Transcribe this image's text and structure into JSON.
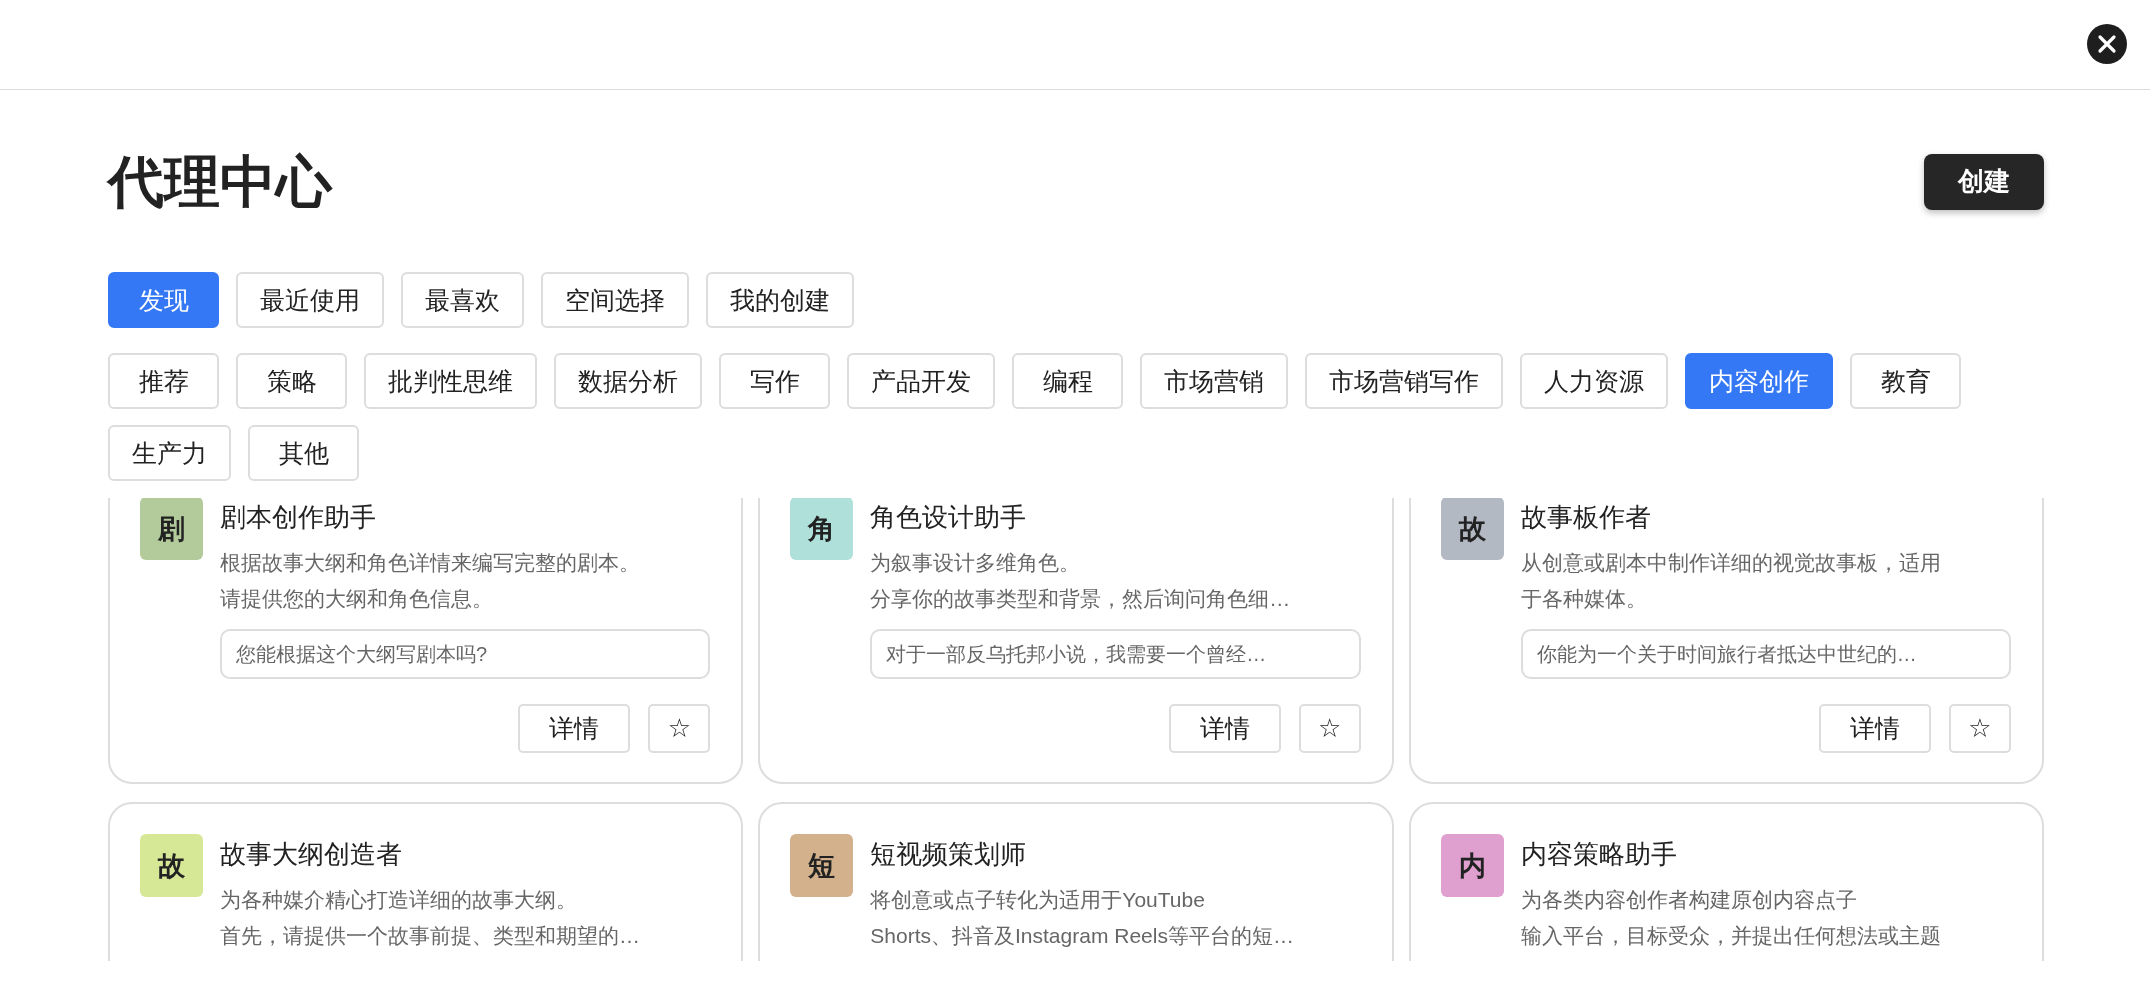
{
  "title": "代理中心",
  "create_button": "创建",
  "tabs": [
    {
      "label": "发现",
      "selected": true
    },
    {
      "label": "最近使用",
      "selected": false
    },
    {
      "label": "最喜欢",
      "selected": false
    },
    {
      "label": "空间选择",
      "selected": false
    },
    {
      "label": "我的创建",
      "selected": false
    }
  ],
  "categories": [
    {
      "label": "推荐",
      "selected": false
    },
    {
      "label": "策略",
      "selected": false
    },
    {
      "label": "批判性思维",
      "selected": false
    },
    {
      "label": "数据分析",
      "selected": false
    },
    {
      "label": "写作",
      "selected": false
    },
    {
      "label": "产品开发",
      "selected": false
    },
    {
      "label": "编程",
      "selected": false
    },
    {
      "label": "市场营销",
      "selected": false
    },
    {
      "label": "市场营销写作",
      "selected": false
    },
    {
      "label": "人力资源",
      "selected": false
    },
    {
      "label": "内容创作",
      "selected": true
    },
    {
      "label": "教育",
      "selected": false
    },
    {
      "label": "生产力",
      "selected": false
    },
    {
      "label": "其他",
      "selected": false
    }
  ],
  "cards": [
    {
      "avatar": "剧",
      "color": "#b3cb9b",
      "name": "剧本创作助手",
      "description": [
        "根据故事大纲和角色详情来编写完整的剧本。",
        "请提供您的大纲和角色信息。"
      ],
      "placeholder": "您能根据这个大纲写剧本吗?",
      "details_button": "详情",
      "star": "☆"
    },
    {
      "avatar": "角",
      "color": "#afe0da",
      "name": "角色设计助手",
      "description": [
        "为叙事设计多维角色。",
        "分享你的故事类型和背景，然后询问角色细…"
      ],
      "placeholder": "对于一部反乌托邦小说，我需要一个曾经…",
      "details_button": "详情",
      "star": "☆"
    },
    {
      "avatar": "故",
      "color": "#b3b9c3",
      "name": "故事板作者",
      "description": [
        "从创意或剧本中制作详细的视觉故事板，适用",
        "于各种媒体。"
      ],
      "placeholder": "你能为一个关于时间旅行者抵达中世纪的…",
      "details_button": "详情",
      "star": "☆"
    },
    {
      "avatar": "故",
      "color": "#d6e796",
      "name": "故事大纲创造者",
      "description": [
        "为各种媒介精心打造详细的故事大纲。",
        "首先，请提供一个故事前提、类型和期望的…"
      ]
    },
    {
      "avatar": "短",
      "color": "#d3b18c",
      "name": "短视频策划师",
      "description": [
        "将创意或点子转化为适用于YouTube",
        "Shorts、抖音及Instagram Reels等平台的短…"
      ]
    },
    {
      "avatar": "内",
      "color": "#df9fcf",
      "name": "内容策略助手",
      "description": [
        "为各类内容创作者构建原创内容点子",
        "输入平台，目标受众，并提出任何想法或主题"
      ]
    }
  ]
}
